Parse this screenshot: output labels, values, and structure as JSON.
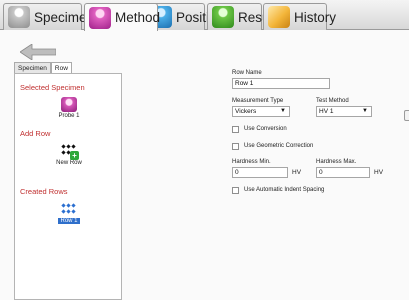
{
  "tabs": [
    {
      "label": "Specimen",
      "icon": "specimen-icon"
    },
    {
      "label": "Method",
      "icon": "method-icon"
    },
    {
      "label": "Position",
      "icon": "position-icon"
    },
    {
      "label": "Result",
      "icon": "result-icon"
    },
    {
      "label": "History",
      "icon": "history-icon"
    }
  ],
  "active_tab": "Method",
  "sidebar": {
    "tabs": [
      "Specimen",
      "Row"
    ],
    "active_tab": "Row",
    "selected_specimen_title": "Selected Specimen",
    "selected_specimen_item": "Probe 1",
    "add_row_title": "Add Row",
    "add_row_item": "New Row",
    "created_rows_title": "Created Rows",
    "created_rows": [
      "Row 1"
    ]
  },
  "form": {
    "row_name_label": "Row Name",
    "row_name_value": "Row 1",
    "measurement_type_label": "Measurement Type",
    "measurement_type_value": "Vickers",
    "test_method_label": "Test Method",
    "test_method_value": "HV 1",
    "use_conversion_label": "Use Conversion",
    "use_conversion_checked": false,
    "use_geometric_correction_label": "Use Geometric Correction",
    "use_geometric_correction_checked": false,
    "hardness_min_label": "Hardness Min.",
    "hardness_min_value": "0",
    "hardness_min_unit": "HV",
    "hardness_max_label": "Hardness Max.",
    "hardness_max_value": "0",
    "hardness_max_unit": "HV",
    "use_auto_indent_label": "Use Automatic Indent Spacing",
    "use_auto_indent_checked": false
  },
  "colors": {
    "section_title": "#c03030",
    "selected_row": "#2f6fcb",
    "add_plus": "#2ea83a"
  }
}
